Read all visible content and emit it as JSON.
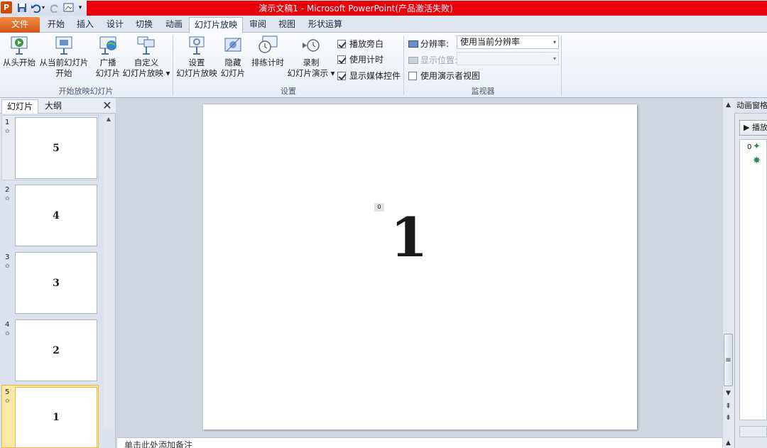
{
  "window": {
    "title": "演示文稿1 - Microsoft PowerPoint(产品激活失败)",
    "app_icon": "P"
  },
  "qat": {
    "save": "save-icon",
    "undo": "undo-icon",
    "redo": "redo-icon"
  },
  "tabs": [
    "文件",
    "开始",
    "插入",
    "设计",
    "切换",
    "动画",
    "幻灯片放映",
    "审阅",
    "视图",
    "形状运算"
  ],
  "active_tab": "幻灯片放映",
  "ribbon": {
    "group_start": {
      "label": "开始放映幻灯片",
      "buttons": [
        {
          "line1": "从头开始",
          "line2": ""
        },
        {
          "line1": "从当前幻灯片",
          "line2": "开始"
        },
        {
          "line1": "广播",
          "line2": "幻灯片"
        },
        {
          "line1": "自定义",
          "line2": "幻灯片放映"
        }
      ]
    },
    "group_setup": {
      "label": "设置",
      "buttons": [
        {
          "line1": "设置",
          "line2": "幻灯片放映"
        },
        {
          "line1": "隐藏",
          "line2": "幻灯片"
        },
        {
          "line1": "排练计时",
          "line2": ""
        },
        {
          "line1": "录制",
          "line2": "幻灯片演示"
        }
      ],
      "checks": [
        {
          "label": "播放旁白",
          "checked": true
        },
        {
          "label": "使用计时",
          "checked": true
        },
        {
          "label": "显示媒体控件",
          "checked": true
        }
      ]
    },
    "group_monitor": {
      "label": "监视器",
      "resolution_label": "分辨率:",
      "resolution_value": "使用当前分辨率",
      "display_label": "显示位置:",
      "display_value": "",
      "presenter_view": "使用演示者视图",
      "presenter_checked": false
    }
  },
  "left_pane": {
    "tabs": [
      "幻灯片",
      "大纲"
    ],
    "close": "close-icon",
    "slides": [
      {
        "num": "1",
        "content": "5"
      },
      {
        "num": "2",
        "content": "4"
      },
      {
        "num": "3",
        "content": "3"
      },
      {
        "num": "4",
        "content": "2"
      },
      {
        "num": "5",
        "content": "1"
      }
    ],
    "selected_index": 4
  },
  "slide": {
    "content": "1",
    "anim_tag": "0"
  },
  "notes": {
    "placeholder": "单击此处添加备注"
  },
  "anim_pane": {
    "title": "动画窗格",
    "play": "▶ 播放",
    "item_number": "0"
  },
  "colors": {
    "title_red": "#e8000b",
    "file_tab": "#d2581c",
    "selected_thumb": "#f5c84a"
  }
}
